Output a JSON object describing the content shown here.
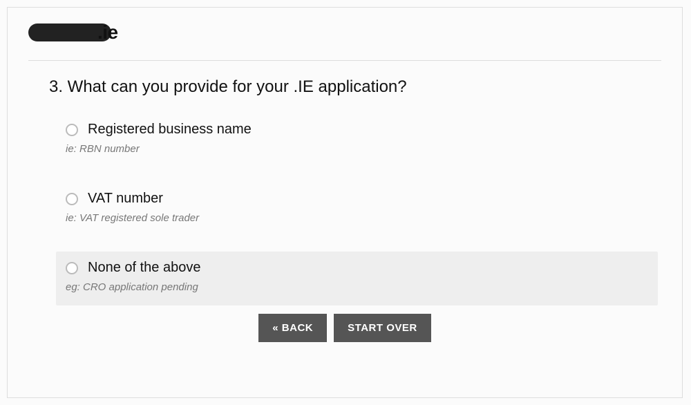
{
  "logo_suffix": ".ie",
  "question": "3. What can you provide for your .IE application?",
  "options": [
    {
      "label": "Registered business name",
      "hint": "ie: RBN number",
      "selected": false
    },
    {
      "label": "VAT number",
      "hint": "ie: VAT registered sole trader",
      "selected": false
    },
    {
      "label": "None of the above",
      "hint": "eg: CRO application pending",
      "selected": true
    }
  ],
  "buttons": {
    "back": "« BACK",
    "start_over": "START OVER"
  }
}
